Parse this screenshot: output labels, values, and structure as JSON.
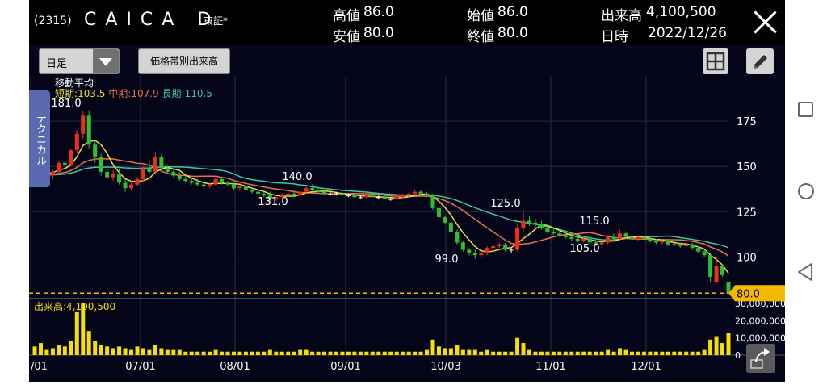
{
  "header": {
    "code": "(2315)",
    "name": "CAICA D",
    "market": "東証*",
    "quotes": [
      {
        "label": "高値",
        "value": "86.0"
      },
      {
        "label": "安値",
        "value": "80.0"
      },
      {
        "label": "始値",
        "value": "86.0"
      },
      {
        "label": "終値",
        "value": "80.0"
      },
      {
        "label": "出来高",
        "value": "4,100,500"
      },
      {
        "label": "日時",
        "value": "2022/12/26"
      }
    ]
  },
  "toolbar": {
    "period": "日足",
    "volume_by_price": "価格帯別出来高"
  },
  "side_tab": "テクニカル",
  "colors": {
    "up": "#e8301c",
    "down": "#2ec02e",
    "ma_short": "#e8e040",
    "ma_mid": "#e87050",
    "ma_long": "#3cc8a0",
    "price_line": "#f5b800",
    "volume": "#f5e000",
    "background": "#05051a"
  },
  "chart_data": {
    "type": "candlestick",
    "price_axis": {
      "ticks": [
        100,
        125,
        150,
        175
      ],
      "range": [
        77,
        200
      ]
    },
    "volume_axis": {
      "ticks": [
        0,
        10000000,
        20000000,
        30000000
      ],
      "tick_labels": [
        "0",
        "10,000,000",
        "20,000,000",
        "30,000,000"
      ],
      "range": [
        0,
        30000000
      ]
    },
    "x_labels": [
      "/01",
      "07/01",
      "08/01",
      "09/01",
      "10/03",
      "11/01",
      "12/01"
    ],
    "moving_average": {
      "title": "移動平均",
      "short": {
        "label": "短期",
        "value": "103.5"
      },
      "mid": {
        "label": "中期",
        "value": "107.9"
      },
      "long": {
        "label": "長期",
        "value": "110.5"
      }
    },
    "annotations": [
      "181.0",
      "131.0",
      "140.0",
      "99.0",
      "125.0",
      "115.0",
      "105.0"
    ],
    "current_price": "80.0",
    "volume_label": "出来高:4,100,500",
    "series": [
      {
        "o": 148,
        "h": 152,
        "l": 145,
        "c": 147
      },
      {
        "o": 147,
        "h": 151,
        "l": 144,
        "c": 149
      },
      {
        "o": 149,
        "h": 152,
        "l": 144,
        "c": 145
      },
      {
        "o": 145,
        "h": 148,
        "l": 143,
        "c": 147
      },
      {
        "o": 147,
        "h": 153,
        "l": 146,
        "c": 152
      },
      {
        "o": 152,
        "h": 153,
        "l": 149,
        "c": 151
      },
      {
        "o": 151,
        "h": 160,
        "l": 150,
        "c": 159
      },
      {
        "o": 159,
        "h": 170,
        "l": 157,
        "c": 168
      },
      {
        "o": 168,
        "h": 181,
        "l": 165,
        "c": 178
      },
      {
        "o": 178,
        "h": 181,
        "l": 160,
        "c": 162
      },
      {
        "o": 162,
        "h": 165,
        "l": 152,
        "c": 155
      },
      {
        "o": 155,
        "h": 157,
        "l": 145,
        "c": 147
      },
      {
        "o": 147,
        "h": 149,
        "l": 142,
        "c": 144
      },
      {
        "o": 144,
        "h": 148,
        "l": 142,
        "c": 146
      },
      {
        "o": 146,
        "h": 149,
        "l": 140,
        "c": 141
      },
      {
        "o": 141,
        "h": 143,
        "l": 136,
        "c": 138
      },
      {
        "o": 138,
        "h": 142,
        "l": 137,
        "c": 140
      },
      {
        "o": 140,
        "h": 144,
        "l": 139,
        "c": 143
      },
      {
        "o": 143,
        "h": 150,
        "l": 142,
        "c": 149
      },
      {
        "o": 149,
        "h": 153,
        "l": 146,
        "c": 147
      },
      {
        "o": 147,
        "h": 158,
        "l": 146,
        "c": 155
      },
      {
        "o": 155,
        "h": 157,
        "l": 148,
        "c": 149
      },
      {
        "o": 149,
        "h": 151,
        "l": 146,
        "c": 147
      },
      {
        "o": 147,
        "h": 149,
        "l": 144,
        "c": 145
      },
      {
        "o": 145,
        "h": 147,
        "l": 142,
        "c": 143
      },
      {
        "o": 143,
        "h": 145,
        "l": 141,
        "c": 142
      },
      {
        "o": 142,
        "h": 143,
        "l": 140,
        "c": 141
      },
      {
        "o": 141,
        "h": 143,
        "l": 139,
        "c": 140
      },
      {
        "o": 140,
        "h": 142,
        "l": 138,
        "c": 139
      },
      {
        "o": 139,
        "h": 141,
        "l": 138,
        "c": 140
      },
      {
        "o": 140,
        "h": 144,
        "l": 139,
        "c": 143
      },
      {
        "o": 143,
        "h": 144,
        "l": 140,
        "c": 141
      },
      {
        "o": 141,
        "h": 142,
        "l": 139,
        "c": 140
      },
      {
        "o": 140,
        "h": 141,
        "l": 137,
        "c": 138
      },
      {
        "o": 138,
        "h": 140,
        "l": 137,
        "c": 139
      },
      {
        "o": 139,
        "h": 140,
        "l": 136,
        "c": 137
      },
      {
        "o": 137,
        "h": 138,
        "l": 135,
        "c": 136
      },
      {
        "o": 136,
        "h": 137,
        "l": 134,
        "c": 135
      },
      {
        "o": 135,
        "h": 136,
        "l": 133,
        "c": 134
      },
      {
        "o": 134,
        "h": 136,
        "l": 131,
        "c": 132
      },
      {
        "o": 132,
        "h": 134,
        "l": 131,
        "c": 133
      },
      {
        "o": 133,
        "h": 135,
        "l": 132,
        "c": 134
      },
      {
        "o": 134,
        "h": 136,
        "l": 133,
        "c": 135
      },
      {
        "o": 135,
        "h": 137,
        "l": 133,
        "c": 134
      },
      {
        "o": 134,
        "h": 137,
        "l": 133,
        "c": 136
      },
      {
        "o": 136,
        "h": 139,
        "l": 135,
        "c": 138
      },
      {
        "o": 138,
        "h": 140,
        "l": 136,
        "c": 137
      },
      {
        "o": 137,
        "h": 138,
        "l": 135,
        "c": 136
      },
      {
        "o": 136,
        "h": 137,
        "l": 134,
        "c": 135
      },
      {
        "o": 135,
        "h": 136,
        "l": 134,
        "c": 135
      },
      {
        "o": 135,
        "h": 136,
        "l": 134,
        "c": 135
      },
      {
        "o": 135,
        "h": 136,
        "l": 134,
        "c": 134
      },
      {
        "o": 134,
        "h": 135,
        "l": 133,
        "c": 134
      },
      {
        "o": 134,
        "h": 135,
        "l": 133,
        "c": 133
      },
      {
        "o": 133,
        "h": 134,
        "l": 132,
        "c": 133
      },
      {
        "o": 133,
        "h": 134,
        "l": 132,
        "c": 134
      },
      {
        "o": 134,
        "h": 135,
        "l": 133,
        "c": 133
      },
      {
        "o": 133,
        "h": 134,
        "l": 132,
        "c": 133
      },
      {
        "o": 133,
        "h": 134,
        "l": 132,
        "c": 132
      },
      {
        "o": 132,
        "h": 133,
        "l": 131,
        "c": 132
      },
      {
        "o": 132,
        "h": 134,
        "l": 131,
        "c": 133
      },
      {
        "o": 133,
        "h": 135,
        "l": 132,
        "c": 134
      },
      {
        "o": 134,
        "h": 136,
        "l": 133,
        "c": 135
      },
      {
        "o": 135,
        "h": 137,
        "l": 134,
        "c": 136
      },
      {
        "o": 136,
        "h": 137,
        "l": 134,
        "c": 135
      },
      {
        "o": 135,
        "h": 136,
        "l": 133,
        "c": 134
      },
      {
        "o": 134,
        "h": 135,
        "l": 126,
        "c": 127
      },
      {
        "o": 127,
        "h": 128,
        "l": 121,
        "c": 122
      },
      {
        "o": 122,
        "h": 123,
        "l": 118,
        "c": 119
      },
      {
        "o": 119,
        "h": 120,
        "l": 113,
        "c": 114
      },
      {
        "o": 114,
        "h": 115,
        "l": 107,
        "c": 108
      },
      {
        "o": 108,
        "h": 109,
        "l": 103,
        "c": 104
      },
      {
        "o": 104,
        "h": 105,
        "l": 101,
        "c": 102
      },
      {
        "o": 102,
        "h": 104,
        "l": 99,
        "c": 101
      },
      {
        "o": 101,
        "h": 103,
        "l": 99,
        "c": 102
      },
      {
        "o": 102,
        "h": 106,
        "l": 101,
        "c": 105
      },
      {
        "o": 105,
        "h": 107,
        "l": 103,
        "c": 106
      },
      {
        "o": 106,
        "h": 108,
        "l": 105,
        "c": 107
      },
      {
        "o": 107,
        "h": 108,
        "l": 103,
        "c": 104
      },
      {
        "o": 104,
        "h": 105,
        "l": 102,
        "c": 104
      },
      {
        "o": 104,
        "h": 118,
        "l": 103,
        "c": 116
      },
      {
        "o": 116,
        "h": 125,
        "l": 114,
        "c": 120
      },
      {
        "o": 120,
        "h": 123,
        "l": 117,
        "c": 119
      },
      {
        "o": 119,
        "h": 121,
        "l": 116,
        "c": 118
      },
      {
        "o": 118,
        "h": 120,
        "l": 115,
        "c": 116
      },
      {
        "o": 116,
        "h": 118,
        "l": 113,
        "c": 114
      },
      {
        "o": 114,
        "h": 116,
        "l": 112,
        "c": 113
      },
      {
        "o": 113,
        "h": 115,
        "l": 111,
        "c": 112
      },
      {
        "o": 112,
        "h": 114,
        "l": 110,
        "c": 111
      },
      {
        "o": 111,
        "h": 113,
        "l": 109,
        "c": 110
      },
      {
        "o": 110,
        "h": 112,
        "l": 108,
        "c": 109
      },
      {
        "o": 109,
        "h": 111,
        "l": 108,
        "c": 110
      },
      {
        "o": 110,
        "h": 111,
        "l": 107,
        "c": 108
      },
      {
        "o": 108,
        "h": 110,
        "l": 106,
        "c": 107
      },
      {
        "o": 107,
        "h": 109,
        "l": 105,
        "c": 108
      },
      {
        "o": 108,
        "h": 112,
        "l": 107,
        "c": 111
      },
      {
        "o": 111,
        "h": 113,
        "l": 109,
        "c": 110
      },
      {
        "o": 110,
        "h": 115,
        "l": 109,
        "c": 113
      },
      {
        "o": 113,
        "h": 114,
        "l": 110,
        "c": 111
      },
      {
        "o": 111,
        "h": 112,
        "l": 109,
        "c": 110
      },
      {
        "o": 110,
        "h": 112,
        "l": 109,
        "c": 111
      },
      {
        "o": 111,
        "h": 112,
        "l": 109,
        "c": 110
      },
      {
        "o": 110,
        "h": 111,
        "l": 108,
        "c": 109
      },
      {
        "o": 109,
        "h": 110,
        "l": 107,
        "c": 108
      },
      {
        "o": 108,
        "h": 110,
        "l": 107,
        "c": 109
      },
      {
        "o": 109,
        "h": 110,
        "l": 106,
        "c": 107
      },
      {
        "o": 107,
        "h": 108,
        "l": 106,
        "c": 107
      },
      {
        "o": 107,
        "h": 108,
        "l": 105,
        "c": 106
      },
      {
        "o": 106,
        "h": 108,
        "l": 105,
        "c": 107
      },
      {
        "o": 107,
        "h": 108,
        "l": 104,
        "c": 105
      },
      {
        "o": 105,
        "h": 106,
        "l": 102,
        "c": 103
      },
      {
        "o": 103,
        "h": 104,
        "l": 100,
        "c": 101
      },
      {
        "o": 101,
        "h": 102,
        "l": 86,
        "c": 89
      },
      {
        "o": 86,
        "h": 100,
        "l": 85,
        "c": 95
      },
      {
        "o": 95,
        "h": 96,
        "l": 89,
        "c": 90
      },
      {
        "o": 86,
        "h": 86,
        "l": 80,
        "c": 80
      }
    ],
    "volume": [
      5,
      7,
      3,
      4,
      6,
      5,
      8,
      25,
      30,
      14,
      8,
      6,
      5,
      4,
      5,
      4,
      3,
      5,
      4,
      3,
      6,
      4,
      3,
      3,
      3,
      2,
      2,
      2,
      2,
      2,
      3,
      2,
      2,
      2,
      2,
      2,
      2,
      2,
      2,
      3,
      2,
      2,
      2,
      2,
      3,
      3,
      2,
      2,
      2,
      2,
      2,
      2,
      2,
      2,
      2,
      2,
      2,
      2,
      2,
      2,
      2,
      2,
      2,
      2,
      2,
      3,
      9,
      5,
      4,
      4,
      6,
      3,
      3,
      3,
      2,
      3,
      2,
      2,
      2,
      2,
      10,
      7,
      3,
      2,
      2,
      2,
      2,
      2,
      2,
      2,
      2,
      2,
      2,
      2,
      2,
      3,
      2,
      4,
      3,
      2,
      2,
      2,
      2,
      2,
      2,
      2,
      2,
      2,
      2,
      2,
      2,
      3,
      9,
      11,
      7,
      13
    ]
  },
  "navbar": {
    "recent_icon": "square-icon",
    "home_icon": "circle-icon",
    "back_icon": "triangle-back-icon"
  }
}
